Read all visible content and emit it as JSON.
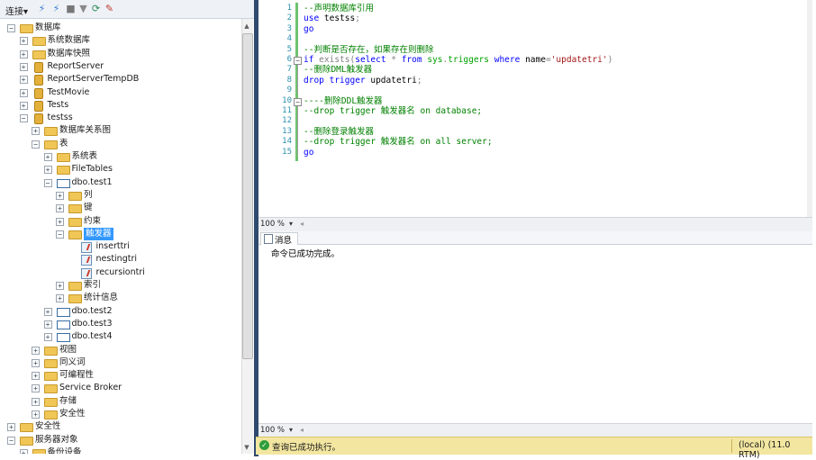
{
  "toolbar": {
    "connect_label": "连接▾"
  },
  "tree": [
    {
      "label": "数据库",
      "level": 1,
      "expand": "−",
      "icon": "folder"
    },
    {
      "label": "系统数据库",
      "level": 2,
      "expand": "+",
      "icon": "folder"
    },
    {
      "label": "数据库快照",
      "level": 2,
      "expand": "+",
      "icon": "folder"
    },
    {
      "label": "ReportServer",
      "level": 2,
      "expand": "+",
      "icon": "db"
    },
    {
      "label": "ReportServerTempDB",
      "level": 2,
      "expand": "+",
      "icon": "db"
    },
    {
      "label": "TestMovie",
      "level": 2,
      "expand": "+",
      "icon": "db"
    },
    {
      "label": "Tests",
      "level": 2,
      "expand": "+",
      "icon": "db"
    },
    {
      "label": "testss",
      "level": 2,
      "expand": "−",
      "icon": "db"
    },
    {
      "label": "数据库关系图",
      "level": 3,
      "expand": "+",
      "icon": "folder"
    },
    {
      "label": "表",
      "level": 3,
      "expand": "−",
      "icon": "folder"
    },
    {
      "label": "系统表",
      "level": 4,
      "expand": "+",
      "icon": "folder"
    },
    {
      "label": "FileTables",
      "level": 4,
      "expand": "+",
      "icon": "folder"
    },
    {
      "label": "dbo.test1",
      "level": 4,
      "expand": "−",
      "icon": "table"
    },
    {
      "label": "列",
      "level": 5,
      "expand": "+",
      "icon": "folder"
    },
    {
      "label": "键",
      "level": 5,
      "expand": "+",
      "icon": "folder"
    },
    {
      "label": "约束",
      "level": 5,
      "expand": "+",
      "icon": "folder"
    },
    {
      "label": "触发器",
      "level": 5,
      "expand": "−",
      "icon": "folder",
      "selected": true
    },
    {
      "label": "inserttri",
      "level": 6,
      "expand": "",
      "icon": "trigger"
    },
    {
      "label": "nestingtri",
      "level": 6,
      "expand": "",
      "icon": "trigger"
    },
    {
      "label": "recursiontri",
      "level": 6,
      "expand": "",
      "icon": "trigger"
    },
    {
      "label": "索引",
      "level": 5,
      "expand": "+",
      "icon": "folder"
    },
    {
      "label": "统计信息",
      "level": 5,
      "expand": "+",
      "icon": "folder"
    },
    {
      "label": "dbo.test2",
      "level": 4,
      "expand": "+",
      "icon": "table"
    },
    {
      "label": "dbo.test3",
      "level": 4,
      "expand": "+",
      "icon": "table"
    },
    {
      "label": "dbo.test4",
      "level": 4,
      "expand": "+",
      "icon": "table"
    },
    {
      "label": "视图",
      "level": 3,
      "expand": "+",
      "icon": "folder"
    },
    {
      "label": "同义词",
      "level": 3,
      "expand": "+",
      "icon": "folder"
    },
    {
      "label": "可编程性",
      "level": 3,
      "expand": "+",
      "icon": "folder"
    },
    {
      "label": "Service Broker",
      "level": 3,
      "expand": "+",
      "icon": "folder"
    },
    {
      "label": "存储",
      "level": 3,
      "expand": "+",
      "icon": "folder"
    },
    {
      "label": "安全性",
      "level": 3,
      "expand": "+",
      "icon": "folder"
    },
    {
      "label": "安全性",
      "level": 1,
      "expand": "+",
      "icon": "folder"
    },
    {
      "label": "服务器对象",
      "level": 1,
      "expand": "−",
      "icon": "folder"
    },
    {
      "label": "备份设备",
      "level": 2,
      "expand": "+",
      "icon": "folder"
    }
  ],
  "editor": {
    "line_numbers": [
      "1",
      "2",
      "3",
      "4",
      "5",
      "6",
      "7",
      "8",
      "9",
      "10",
      "11",
      "12",
      "13",
      "14",
      "15"
    ],
    "lines": [
      [
        {
          "t": "--声明数据库引用",
          "c": "comment"
        }
      ],
      [
        {
          "t": "use ",
          "c": "key"
        },
        {
          "t": "testss",
          "c": "plain"
        },
        {
          "t": ";",
          "c": "gray"
        }
      ],
      [
        {
          "t": "go",
          "c": "key"
        }
      ],
      [],
      [
        {
          "t": "--判断是否存在，如果存在则删除",
          "c": "comment"
        }
      ],
      [
        {
          "t": "if ",
          "c": "key"
        },
        {
          "t": "exists",
          "c": "gray"
        },
        {
          "t": "(",
          "c": "gray"
        },
        {
          "t": "select ",
          "c": "key"
        },
        {
          "t": "* ",
          "c": "gray"
        },
        {
          "t": "from ",
          "c": "key"
        },
        {
          "t": "sys",
          "c": "sys"
        },
        {
          "t": ".",
          "c": "gray"
        },
        {
          "t": "triggers ",
          "c": "sys"
        },
        {
          "t": "where ",
          "c": "key"
        },
        {
          "t": "name",
          "c": "plain"
        },
        {
          "t": "=",
          "c": "gray"
        },
        {
          "t": "'updatetri'",
          "c": "str"
        },
        {
          "t": ")",
          "c": "gray"
        }
      ],
      [
        {
          "t": "--删除DML触发器",
          "c": "comment"
        }
      ],
      [
        {
          "t": "drop trigger ",
          "c": "key"
        },
        {
          "t": "updatetri",
          "c": "plain"
        },
        {
          "t": ";",
          "c": "gray"
        }
      ],
      [],
      [
        {
          "t": "----删除DDL触发器",
          "c": "comment"
        }
      ],
      [
        {
          "t": "--drop trigger 触发器名 on database;",
          "c": "comment"
        }
      ],
      [],
      [
        {
          "t": "--删除登录触发器",
          "c": "comment"
        }
      ],
      [
        {
          "t": "--drop trigger 触发器名 on all server;",
          "c": "comment"
        }
      ],
      [
        {
          "t": "go",
          "c": "key"
        }
      ]
    ],
    "zoom": "100 %"
  },
  "results": {
    "tab_label": "消息",
    "message": "命令已成功完成。",
    "zoom": "100 %"
  },
  "status": {
    "text": "查询已成功执行。",
    "server": "(local) (11.0 RTM)"
  }
}
